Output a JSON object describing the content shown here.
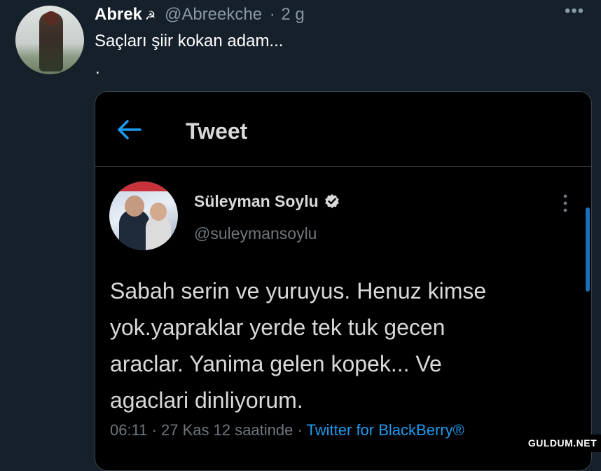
{
  "tweet": {
    "author_name": "Abrek",
    "author_emoji": "☭",
    "author_handle": "@Abreekche",
    "separator": "·",
    "time": "2 g",
    "text": "Saçları şiir kokan adam...",
    "trailing": ".",
    "more_icon": "more-horizontal-icon"
  },
  "embedded_screenshot": {
    "header": {
      "back_icon": "arrow-left-icon",
      "title": "Tweet"
    },
    "author_name": "Süleyman Soylu",
    "verified_icon": "verified-badge-icon",
    "author_handle": "@suleymansoylu",
    "text_lines": [
      "Sabah serin ve yuruyus. Henuz kimse",
      "yok.yapraklar yerde tek tuk gecen",
      "araclar. Yanima gelen kopek... Ve",
      "agaclari dinliyorum."
    ],
    "meta": {
      "time": "06:11",
      "date": "27 Kas 12 saatinde",
      "separator": "·",
      "source": "Twitter for BlackBerry®"
    }
  },
  "watermark": "GULDUM.NET",
  "colors": {
    "background": "#15202b",
    "embed_background": "#000000",
    "accent": "#1d9bf0",
    "muted": "#8899a6"
  }
}
